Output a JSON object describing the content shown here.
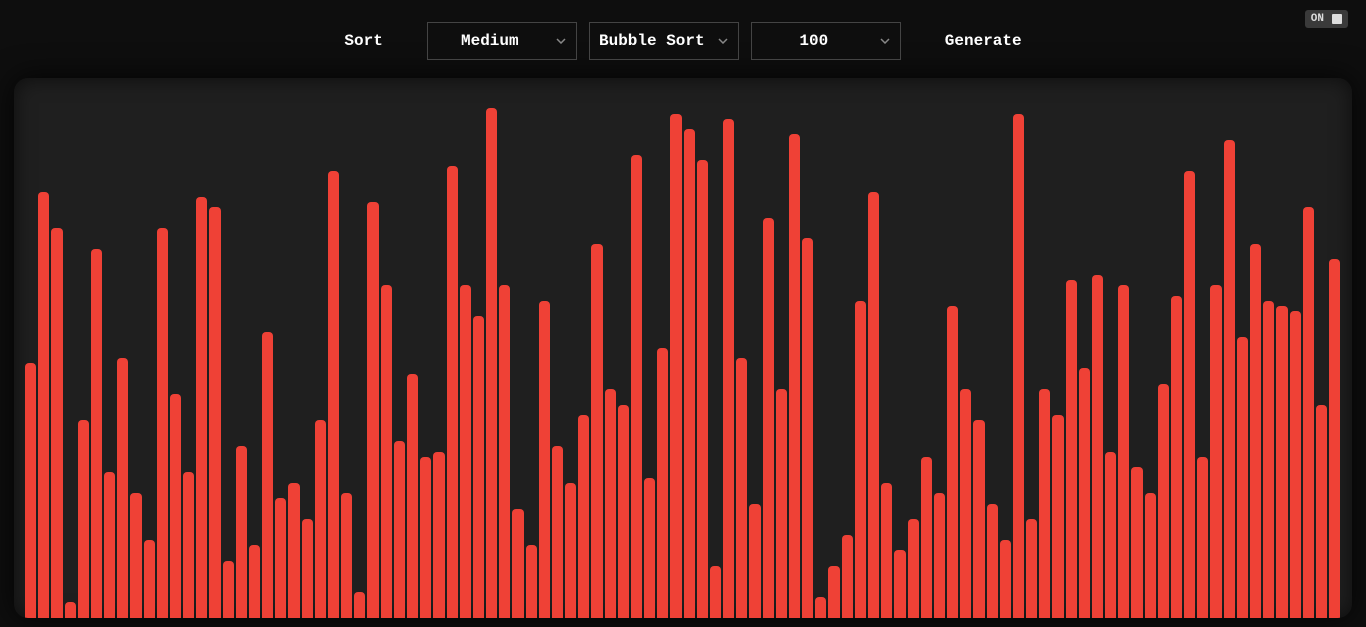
{
  "toolbar": {
    "sort_label": "Sort",
    "generate_label": "Generate",
    "speed": {
      "selected": "Medium"
    },
    "algorithm": {
      "selected": "Bubble Sort"
    },
    "count": {
      "selected": "100"
    }
  },
  "toggle": {
    "state_label": "ON"
  },
  "colors": {
    "bar": "#ef4136",
    "stage_bg": "#1f1f1f",
    "page_bg": "#0e0e0e"
  },
  "chart_data": {
    "type": "bar",
    "title": "",
    "xlabel": "",
    "ylabel": "",
    "ylim": [
      0,
      100
    ],
    "count": 100,
    "values": [
      49,
      82,
      75,
      3,
      38,
      71,
      28,
      50,
      24,
      15,
      75,
      43,
      28,
      81,
      79,
      11,
      33,
      14,
      55,
      23,
      26,
      19,
      38,
      86,
      24,
      5,
      80,
      64,
      34,
      47,
      31,
      32,
      87,
      64,
      58,
      98,
      64,
      21,
      14,
      61,
      33,
      26,
      39,
      72,
      44,
      41,
      89,
      27,
      52,
      97,
      94,
      88,
      10,
      96,
      50,
      22,
      77,
      44,
      93,
      73,
      4,
      10,
      16,
      61,
      82,
      26,
      13,
      19,
      31,
      24,
      60,
      44,
      38,
      22,
      15,
      97,
      19,
      44,
      39,
      65,
      48,
      66,
      32,
      64,
      29,
      24,
      45,
      62,
      86,
      31,
      64,
      92,
      54,
      72,
      61,
      60,
      59,
      79,
      41,
      69
    ]
  }
}
